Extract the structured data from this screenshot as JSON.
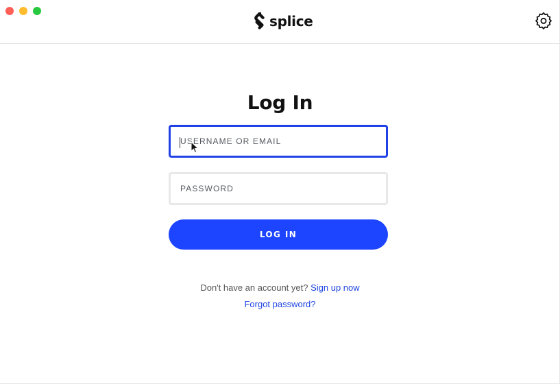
{
  "window": {
    "controls": [
      "close",
      "minimize",
      "zoom"
    ]
  },
  "header": {
    "brand_name": "splice",
    "brand_icon": "splice-logo-icon",
    "settings_icon": "gear-icon"
  },
  "login": {
    "title": "Log In",
    "username": {
      "value": "",
      "placeholder": "USERNAME OR EMAIL"
    },
    "password": {
      "value": "",
      "placeholder": "PASSWORD"
    },
    "submit_label": "LOG IN",
    "signup_prompt": "Don't have an account yet?",
    "signup_link": "Sign up now",
    "forgot_link": "Forgot password?"
  },
  "colors": {
    "accent": "#1d44ff",
    "focus_border": "#1f41e6",
    "link": "#1d44e0",
    "close": "#fe5f57",
    "minimize": "#febc2e",
    "zoom": "#28c840"
  }
}
